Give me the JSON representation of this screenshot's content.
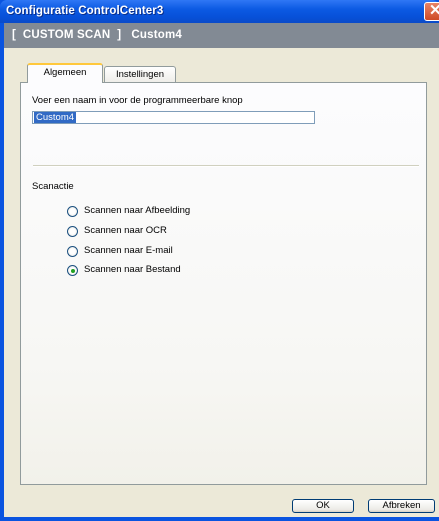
{
  "window": {
    "title": "Configuratie ControlCenter3",
    "close_symbol": "✕"
  },
  "header": {
    "text": "[  CUSTOM SCAN  ]   Custom4"
  },
  "tabs": [
    {
      "label": "Algemeen",
      "active": true
    },
    {
      "label": "Instellingen",
      "active": false
    }
  ],
  "general": {
    "name_label": "Voer een naam in voor de programmeerbare knop",
    "name_value": "Custom4",
    "scan_action_label": "Scanactie",
    "scan_actions": [
      {
        "label": "Scannen naar Afbeelding",
        "selected": false
      },
      {
        "label": "Scannen naar OCR",
        "selected": false
      },
      {
        "label": "Scannen naar E-mail",
        "selected": false
      },
      {
        "label": "Scannen naar Bestand",
        "selected": true
      }
    ]
  },
  "buttons": {
    "ok": "OK",
    "cancel": "Afbreken"
  }
}
